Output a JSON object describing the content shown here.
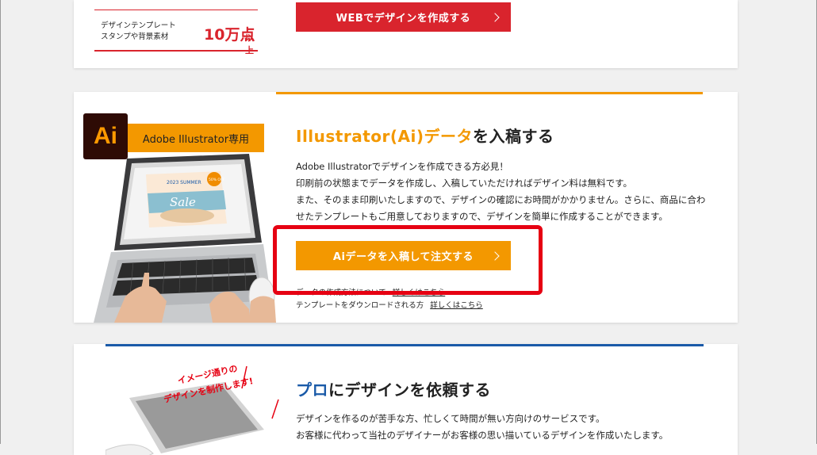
{
  "top_section": {
    "stamp_line1": "デザインテンプレート",
    "stamp_line2": "スタンプや背景素材",
    "stamp_count": "10万点",
    "stamp_suffix": "以上",
    "web_button_label": "WEBでデザインを作成する"
  },
  "ai_section": {
    "logo_text": "Ai",
    "tag_label": "Adobe Illustrator専用",
    "heading_highlight": "Illustrator(Ai)データ",
    "heading_rest": "を入稿する",
    "desc_lines": [
      "Adobe Illustratorでデザインを作成できる方必見！",
      "印刷前の状態までデータを作成し、入稿していただければデザイン料は無料です。",
      "また、そのまま印刷いたしますので、デザインの確認にお時間がかかりません。さらに、商品に合わ",
      "せたテンプレートもご用意しておりますので、デザインを簡単に作成することができます。"
    ],
    "order_button_label": "Aiデータを入稿して注文する",
    "link_row1_text": "データの作成方法について",
    "link_row1_link": "詳しくはこちら",
    "link_row2_text": "テンプレートをダウンロードされる方",
    "link_row2_link": "詳しくはこちら",
    "screen_text": "2023 SUMMER",
    "screen_sale": "Sale",
    "screen_badge": "50% OFF"
  },
  "pro_section": {
    "illust_line1": "イメージ通りの",
    "illust_line2": "デザインを制作します!",
    "heading_highlight": "プロ",
    "heading_rest": "にデザインを依頼する",
    "desc_lines": [
      "デザインを作るのが苦手な方、忙しくて時間が無い方向けのサービスです。",
      "お客様に代わって当社のデザイナーがお客様の思い描いているデザインを作成いたします。"
    ]
  },
  "colors": {
    "accent_orange": "#f39800",
    "accent_red": "#d9242d",
    "accent_blue": "#1a5aa8",
    "highlight_red": "#e60012"
  }
}
